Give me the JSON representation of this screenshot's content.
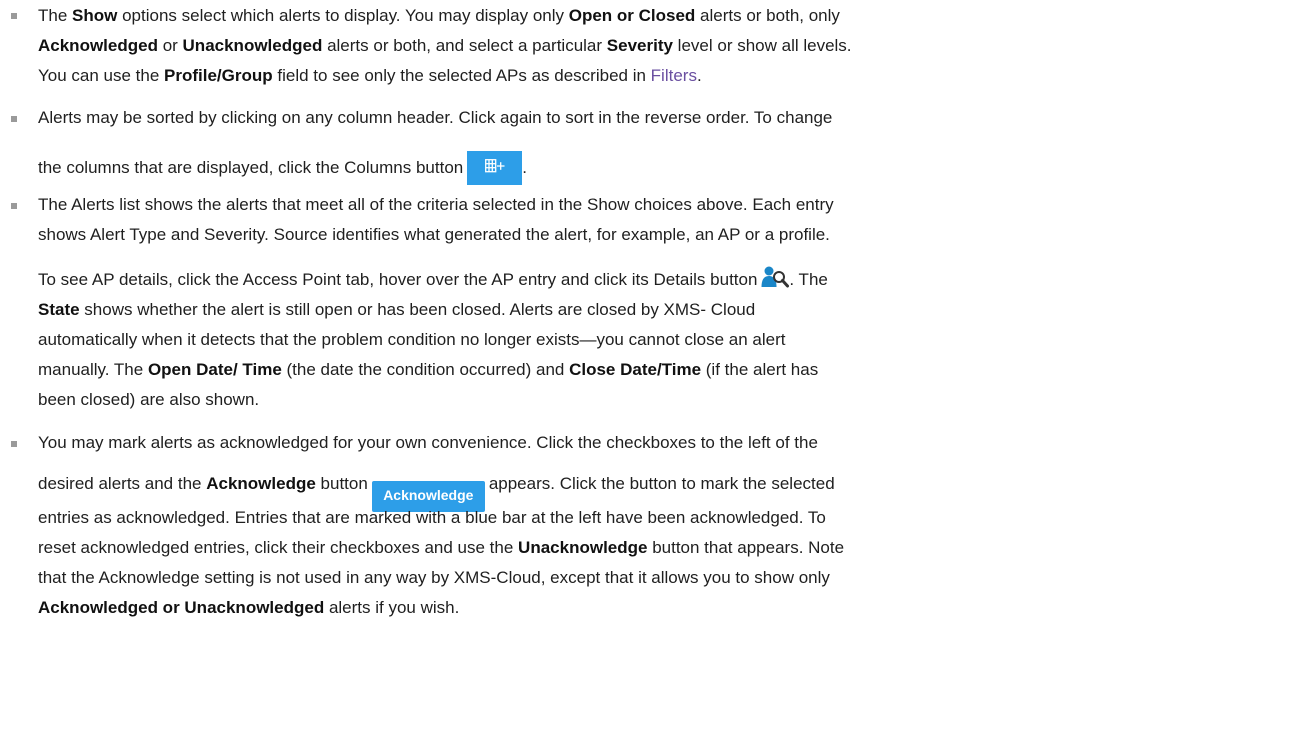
{
  "colors": {
    "text": "#1f1f1f",
    "link": "#6a4fa0",
    "button": "#2d9ee8",
    "marker": "#9a9a9a"
  },
  "bullet1": {
    "l1_a": "The ",
    "l1_b": "Show",
    "l1_c": " options select which alerts to display. You may display only ",
    "l1_d": "Open or Closed",
    "l1_e": " alerts or both, only",
    "l2_a": "Acknowledged",
    "l2_b": " or ",
    "l2_c": "Unacknowledged",
    "l2_d": " alerts or both, and select a particular ",
    "l2_e": "Severity",
    "l2_f": " level or show all levels.",
    "l3_a": "You can use the ",
    "l3_b": "Profile/Group",
    "l3_c": " field to see only the selected APs as described in ",
    "l3_link": "Filters",
    "l3_d": "."
  },
  "bullet2": {
    "l1": "Alerts may be sorted by clicking on any column header. Click again to sort in the reverse order. To change",
    "l2_a": "the columns that are displayed, click the Columns button",
    "l2_b": ".",
    "columns_icon": "columns-add-icon"
  },
  "bullet3": {
    "l1": "The Alerts list shows the alerts that meet all of the criteria selected in the Show choices above. Each entry",
    "l2": "shows Alert Type and Severity. Source identifies what generated the alert, for example, an AP or a profile.",
    "l3_a": "To see AP details, click the Access Point tab, hover over the AP entry and click its Details button",
    "l3_b": ". The",
    "details_icon": "user-search-icon",
    "l4_a": "State",
    "l4_b": " shows whether the alert is still open or has been closed. Alerts are closed by XMS- Cloud",
    "l5": "automatically when it detects that the problem condition no longer exists—you cannot close an alert",
    "l6_a": "manually. The ",
    "l6_b": "Open Date/ Time",
    "l6_c": " (the date the condition occurred) and ",
    "l6_d": "Close Date/Time",
    "l6_e": " (if the alert has",
    "l7": "been closed) are also shown."
  },
  "bullet4": {
    "l1": "You may mark alerts as acknowledged for your own convenience. Click the checkboxes to the left of the",
    "l2_a": "desired alerts and the ",
    "l2_b": "Acknowledge",
    "l2_c": " button",
    "ack_button": "Acknowledge",
    "l2_d": "appears. Click the button to mark the selected",
    "l3": "entries as acknowledged. Entries that are marked with a blue bar at the left have been acknowledged. To",
    "l4_a": "reset acknowledged entries, click their checkboxes and use the ",
    "l4_b": "Unacknowledge",
    "l4_c": " button that appears. Note",
    "l5": "that the Acknowledge setting is not used in any way by XMS-Cloud, except that it allows you to show only",
    "l6_a": "Acknowledged or Unacknowledged",
    "l6_b": " alerts if you wish."
  }
}
